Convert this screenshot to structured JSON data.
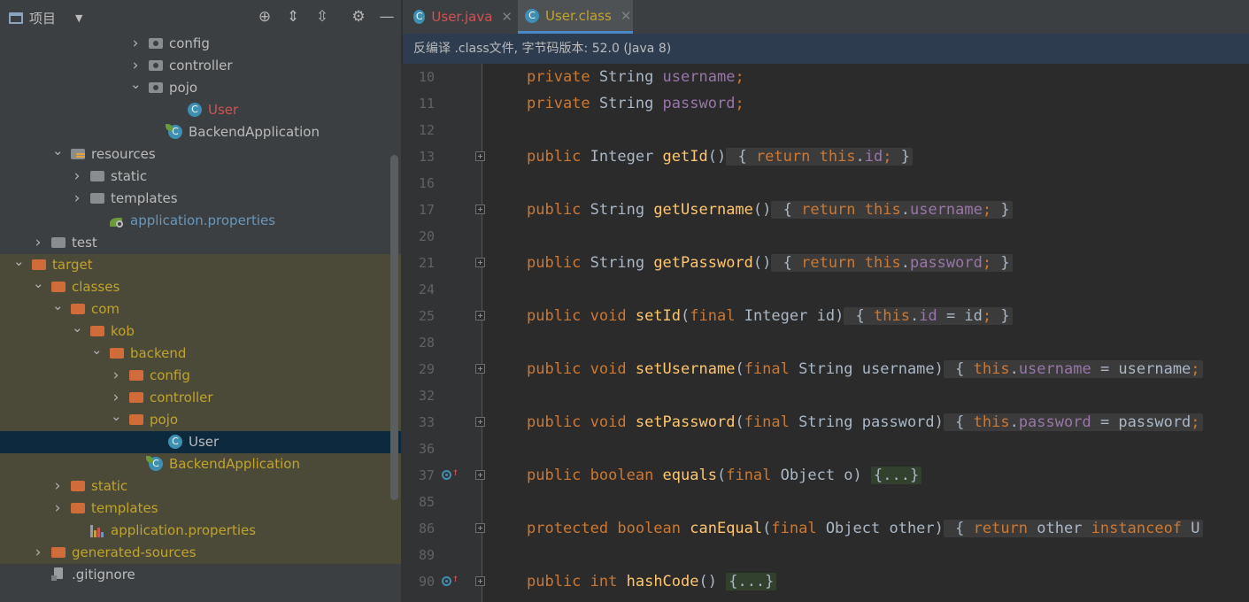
{
  "sidebar": {
    "title": "项目",
    "tree": [
      {
        "label": "config",
        "indent": 7,
        "arrow": "right",
        "icon": "folder-pkg-gray",
        "color": "default"
      },
      {
        "label": "controller",
        "indent": 7,
        "arrow": "right",
        "icon": "folder-pkg-gray",
        "color": "default"
      },
      {
        "label": "pojo",
        "indent": 7,
        "arrow": "down",
        "icon": "folder-pkg-gray",
        "color": "default"
      },
      {
        "label": "User",
        "indent": 9,
        "arrow": "",
        "icon": "class",
        "color": "red"
      },
      {
        "label": "BackendApplication",
        "indent": 8,
        "arrow": "",
        "icon": "spring-class",
        "color": "default"
      },
      {
        "label": "resources",
        "indent": 3,
        "arrow": "down",
        "icon": "folder-res",
        "color": "default"
      },
      {
        "label": "static",
        "indent": 4,
        "arrow": "right",
        "icon": "folder-gray",
        "color": "default"
      },
      {
        "label": "templates",
        "indent": 4,
        "arrow": "right",
        "icon": "folder-gray",
        "color": "default"
      },
      {
        "label": "application.properties",
        "indent": 5,
        "arrow": "",
        "icon": "spring-props",
        "color": "blue"
      },
      {
        "label": "test",
        "indent": 2,
        "arrow": "right",
        "icon": "folder-gray",
        "color": "default"
      },
      {
        "label": "target",
        "indent": 1,
        "arrow": "down",
        "icon": "folder-orange",
        "color": "yellow",
        "hl": true
      },
      {
        "label": "classes",
        "indent": 2,
        "arrow": "down",
        "icon": "folder-orange",
        "color": "yellow",
        "hl": true
      },
      {
        "label": "com",
        "indent": 3,
        "arrow": "down",
        "icon": "folder-orange",
        "color": "yellow",
        "hl": true
      },
      {
        "label": "kob",
        "indent": 4,
        "arrow": "down",
        "icon": "folder-orange",
        "color": "yellow",
        "hl": true
      },
      {
        "label": "backend",
        "indent": 5,
        "arrow": "down",
        "icon": "folder-orange",
        "color": "yellow",
        "hl": true
      },
      {
        "label": "config",
        "indent": 6,
        "arrow": "right",
        "icon": "folder-orange",
        "color": "yellow",
        "hl": true
      },
      {
        "label": "controller",
        "indent": 6,
        "arrow": "right",
        "icon": "folder-orange",
        "color": "yellow",
        "hl": true
      },
      {
        "label": "pojo",
        "indent": 6,
        "arrow": "down",
        "icon": "folder-orange",
        "color": "yellow",
        "hl": true
      },
      {
        "label": "User",
        "indent": 8,
        "arrow": "",
        "icon": "class",
        "color": "sel",
        "sel": true
      },
      {
        "label": "BackendApplication",
        "indent": 7,
        "arrow": "",
        "icon": "spring-class",
        "color": "yellow",
        "hl": true
      },
      {
        "label": "static",
        "indent": 3,
        "arrow": "right",
        "icon": "folder-orange",
        "color": "yellow",
        "hl": true
      },
      {
        "label": "templates",
        "indent": 3,
        "arrow": "right",
        "icon": "folder-orange",
        "color": "yellow",
        "hl": true
      },
      {
        "label": "application.properties",
        "indent": 4,
        "arrow": "",
        "icon": "props",
        "color": "yellow",
        "hl": true
      },
      {
        "label": "generated-sources",
        "indent": 2,
        "arrow": "right",
        "icon": "folder-orange",
        "color": "yellow",
        "hl": true
      },
      {
        "label": ".gitignore",
        "indent": 2,
        "arrow": "",
        "icon": "git",
        "color": "default"
      }
    ]
  },
  "tabs": [
    {
      "label": "User.java",
      "close": "✕",
      "icon": "C"
    },
    {
      "label": "User.class",
      "close": "✕",
      "icon": "C"
    }
  ],
  "notice": "反编译 .class文件, 字节码版本: 52.0 (Java 8)",
  "code": [
    {
      "n": "10",
      "fold": false,
      "mark": false,
      "parts": [
        [
          "kw",
          "private "
        ],
        [
          "ty",
          "String "
        ],
        [
          "fd",
          "username"
        ],
        [
          "semi",
          ";"
        ]
      ]
    },
    {
      "n": "11",
      "fold": false,
      "mark": false,
      "parts": [
        [
          "kw",
          "private "
        ],
        [
          "ty",
          "String "
        ],
        [
          "fd",
          "password"
        ],
        [
          "semi",
          ";"
        ]
      ]
    },
    {
      "n": "12",
      "fold": false,
      "mark": false,
      "parts": []
    },
    {
      "n": "13",
      "fold": true,
      "mark": false,
      "parts": [
        [
          "kw",
          "public "
        ],
        [
          "ty",
          "Integer "
        ],
        [
          "fn",
          "getId"
        ],
        [
          "pl",
          "()"
        ],
        [
          "fb",
          " { "
        ],
        [
          "fbk",
          "return "
        ],
        [
          "fbk",
          "this"
        ],
        [
          "fb",
          "."
        ],
        [
          "fbf",
          "id"
        ],
        [
          "fbs",
          ";"
        ],
        [
          "fb",
          " }"
        ]
      ]
    },
    {
      "n": "16",
      "fold": false,
      "mark": false,
      "parts": []
    },
    {
      "n": "17",
      "fold": true,
      "mark": false,
      "parts": [
        [
          "kw",
          "public "
        ],
        [
          "ty",
          "String "
        ],
        [
          "fn",
          "getUsername"
        ],
        [
          "pl",
          "()"
        ],
        [
          "fb",
          " { "
        ],
        [
          "fbk",
          "return "
        ],
        [
          "fbk",
          "this"
        ],
        [
          "fb",
          "."
        ],
        [
          "fbf",
          "username"
        ],
        [
          "fbs",
          ";"
        ],
        [
          "fb",
          " }"
        ]
      ]
    },
    {
      "n": "20",
      "fold": false,
      "mark": false,
      "parts": []
    },
    {
      "n": "21",
      "fold": true,
      "mark": false,
      "parts": [
        [
          "kw",
          "public "
        ],
        [
          "ty",
          "String "
        ],
        [
          "fn",
          "getPassword"
        ],
        [
          "pl",
          "()"
        ],
        [
          "fb",
          " { "
        ],
        [
          "fbk",
          "return "
        ],
        [
          "fbk",
          "this"
        ],
        [
          "fb",
          "."
        ],
        [
          "fbf",
          "password"
        ],
        [
          "fbs",
          ";"
        ],
        [
          "fb",
          " }"
        ]
      ]
    },
    {
      "n": "24",
      "fold": false,
      "mark": false,
      "parts": []
    },
    {
      "n": "25",
      "fold": true,
      "mark": false,
      "parts": [
        [
          "kw",
          "public "
        ],
        [
          "kw",
          "void "
        ],
        [
          "fn",
          "setId"
        ],
        [
          "pl",
          "("
        ],
        [
          "kw",
          "final "
        ],
        [
          "ty",
          "Integer "
        ],
        [
          "pl",
          "id)"
        ],
        [
          "fb",
          " { "
        ],
        [
          "fbk",
          "this"
        ],
        [
          "fb",
          "."
        ],
        [
          "fbf",
          "id"
        ],
        [
          "fb",
          " = id"
        ],
        [
          "fbs",
          ";"
        ],
        [
          "fb",
          " }"
        ]
      ]
    },
    {
      "n": "28",
      "fold": false,
      "mark": false,
      "parts": []
    },
    {
      "n": "29",
      "fold": true,
      "mark": false,
      "parts": [
        [
          "kw",
          "public "
        ],
        [
          "kw",
          "void "
        ],
        [
          "fn",
          "setUsername"
        ],
        [
          "pl",
          "("
        ],
        [
          "kw",
          "final "
        ],
        [
          "ty",
          "String "
        ],
        [
          "pl",
          "username)"
        ],
        [
          "fb",
          " { "
        ],
        [
          "fbk",
          "this"
        ],
        [
          "fb",
          "."
        ],
        [
          "fbf",
          "username"
        ],
        [
          "fb",
          " = username"
        ],
        [
          "fbs",
          ";"
        ]
      ]
    },
    {
      "n": "32",
      "fold": false,
      "mark": false,
      "parts": []
    },
    {
      "n": "33",
      "fold": true,
      "mark": false,
      "parts": [
        [
          "kw",
          "public "
        ],
        [
          "kw",
          "void "
        ],
        [
          "fn",
          "setPassword"
        ],
        [
          "pl",
          "("
        ],
        [
          "kw",
          "final "
        ],
        [
          "ty",
          "String "
        ],
        [
          "pl",
          "password)"
        ],
        [
          "fb",
          " { "
        ],
        [
          "fbk",
          "this"
        ],
        [
          "fb",
          "."
        ],
        [
          "fbf",
          "password"
        ],
        [
          "fb",
          " = password"
        ],
        [
          "fbs",
          ";"
        ]
      ]
    },
    {
      "n": "36",
      "fold": false,
      "mark": false,
      "parts": []
    },
    {
      "n": "37",
      "fold": true,
      "mark": true,
      "parts": [
        [
          "kw",
          "public "
        ],
        [
          "kw",
          "boolean "
        ],
        [
          "fn",
          "equals"
        ],
        [
          "pl",
          "("
        ],
        [
          "kw",
          "final "
        ],
        [
          "ty",
          "Object "
        ],
        [
          "pl",
          "o) "
        ],
        [
          "fg",
          "{...}"
        ]
      ]
    },
    {
      "n": "85",
      "fold": false,
      "mark": false,
      "parts": []
    },
    {
      "n": "86",
      "fold": true,
      "mark": false,
      "parts": [
        [
          "kw",
          "protected "
        ],
        [
          "kw",
          "boolean "
        ],
        [
          "fn",
          "canEqual"
        ],
        [
          "pl",
          "("
        ],
        [
          "kw",
          "final "
        ],
        [
          "ty",
          "Object "
        ],
        [
          "pl",
          "other)"
        ],
        [
          "fb",
          " { "
        ],
        [
          "fbk",
          "return "
        ],
        [
          "fb",
          "other "
        ],
        [
          "fbk",
          "instanceof "
        ],
        [
          "fb",
          "U"
        ]
      ]
    },
    {
      "n": "89",
      "fold": false,
      "mark": false,
      "parts": []
    },
    {
      "n": "90",
      "fold": true,
      "mark": true,
      "parts": [
        [
          "kw",
          "public "
        ],
        [
          "kw",
          "int "
        ],
        [
          "fn",
          "hashCode"
        ],
        [
          "pl",
          "() "
        ],
        [
          "fg",
          "{...}"
        ]
      ]
    }
  ],
  "colors": {
    "accent": "#4a88c7",
    "keyword": "#cc7832",
    "field": "#9876aa",
    "method": "#ffc66d",
    "modified": "#d25252",
    "excluded": "#c1a32d"
  }
}
